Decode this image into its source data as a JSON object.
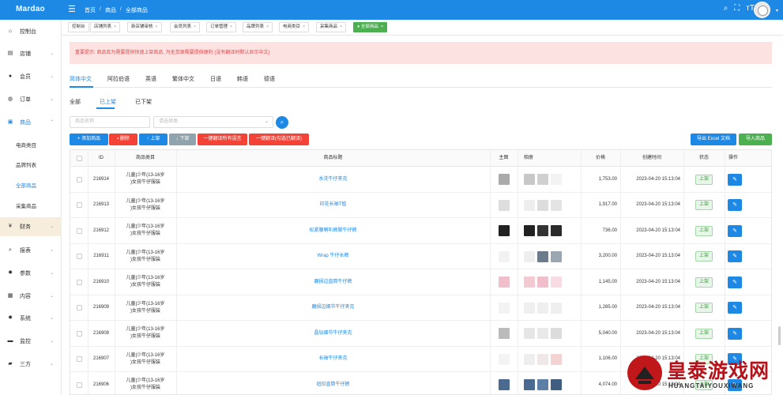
{
  "app": {
    "logo": "Mardao"
  },
  "breadcrumb": [
    "首页",
    "商品",
    "全部商品"
  ],
  "sidebar": {
    "items": [
      {
        "label": "控制台",
        "icon": "home-icon"
      },
      {
        "label": "店铺",
        "icon": "store-icon"
      },
      {
        "label": "会员",
        "icon": "user-icon"
      },
      {
        "label": "订单",
        "icon": "order-icon"
      },
      {
        "label": "商品",
        "icon": "goods-icon"
      },
      {
        "label": "财务",
        "icon": "yen-icon"
      },
      {
        "label": "报表",
        "icon": "search-report-icon"
      },
      {
        "label": "参数",
        "icon": "gear-icon"
      },
      {
        "label": "内容",
        "icon": "content-icon"
      },
      {
        "label": "系统",
        "icon": "system-icon"
      },
      {
        "label": "监控",
        "icon": "monitor-icon"
      },
      {
        "label": "三方",
        "icon": "lock-icon"
      }
    ],
    "goods_sub": [
      "电商类目",
      "品牌列表",
      "全部商品",
      "采集商品"
    ]
  },
  "tabs": [
    "控制台",
    "店铺列表",
    "新店铺审核",
    "会员列表",
    "订单管理",
    "品牌列表",
    "电商类目",
    "采集商品",
    "全部商品"
  ],
  "alert": "重要提示: 商品库为需要提供快速上架商品, 为无货源需要提供便利 (没有翻译时默认显示中文)",
  "language_tabs": [
    "简体中文",
    "阿拉伯语",
    "英语",
    "繁体中文",
    "日语",
    "韩语",
    "德语"
  ],
  "status_tabs": [
    "全部",
    "已上架",
    "已下架"
  ],
  "filters": {
    "name_placeholder": "商品名称",
    "category_placeholder": "请选择类"
  },
  "actions": {
    "add": "+ 添加商品",
    "delete": "删除",
    "on": "上架",
    "off": "下架",
    "translate_all": "一键翻译所有语言",
    "translate_sel": "一键翻译(勾选已翻译)",
    "excel": "导出 Excel 文档",
    "import": "导入商品"
  },
  "table": {
    "headers": [
      "ID",
      "商品类目",
      "商品标题",
      "主图",
      "相册",
      "价格",
      "创建时间",
      "状态",
      "操作"
    ],
    "rows": [
      {
        "id": "216914",
        "category": "儿童|少年(13-16岁)女孩|牛仔服装",
        "title": "水洗牛仔夹克",
        "price": "1,753.00",
        "time": "2023-04-20 15:13:04",
        "status": "上架"
      },
      {
        "id": "216913",
        "category": "儿童|少年(13-16岁)女孩|牛仔服装",
        "title": "印花长袖T恤",
        "price": "1,917.00",
        "time": "2023-04-20 15:13:04",
        "status": "上架"
      },
      {
        "id": "216912",
        "category": "儿童|少年(13-16岁)女孩|牛仔服装",
        "title": "松紧腰喇叭裤脚牛仔裤",
        "price": "736.00",
        "time": "2023-04-20 15:13:04",
        "status": "上架"
      },
      {
        "id": "216911",
        "category": "儿童|少年(13-16岁)女孩|牛仔服装",
        "title": "Wrap 牛仔长裤",
        "price": "3,200.00",
        "time": "2023-04-20 15:13:04",
        "status": "上架"
      },
      {
        "id": "216910",
        "category": "儿童|少年(13-16岁)女孩|牛仔服装",
        "title": "磨损边直筒牛仔裤",
        "price": "1,145.00",
        "time": "2023-04-20 15:13:04",
        "status": "上架"
      },
      {
        "id": "216909",
        "category": "儿童|少年(13-16岁)女孩|牛仔服装",
        "title": "磨损边细节牛仔夹克",
        "price": "1,285.00",
        "time": "2023-04-20 15:13:04",
        "status": "上架"
      },
      {
        "id": "216908",
        "category": "儿童|少年(13-16岁)女孩|牛仔服装",
        "title": "晶钻细节牛仔夹克",
        "price": "5,040.00",
        "time": "2023-04-20 15:13:04",
        "status": "上架"
      },
      {
        "id": "216907",
        "category": "儿童|少年(13-16岁)女孩|牛仔服装",
        "title": "长袖牛仔夹克",
        "price": "1,106.00",
        "time": "2023-04-20 15:13:04",
        "status": "上架"
      },
      {
        "id": "216906",
        "category": "儿童|少年(13-16岁)女孩|牛仔服装",
        "title": "纽扣直筒牛仔裤",
        "price": "4,074.00",
        "time": "2023-04-20 15:13:04",
        "status": "上架"
      }
    ]
  },
  "watermark": {
    "text": "皇泰游戏网",
    "sub": "HUANGTAIYOUXIWANG"
  },
  "colors": {
    "primary": "#1e88e5",
    "success": "#4caf50",
    "danger": "#f44336",
    "alert_bg": "#fde2e2"
  }
}
